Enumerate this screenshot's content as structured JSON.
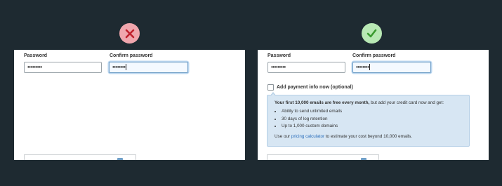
{
  "badges": {
    "bad": "x-icon",
    "good": "check-icon",
    "bad_color": "#f0a6ad",
    "good_color": "#b8e8b4"
  },
  "left": {
    "password_label": "Password",
    "password_value": "•••••••••",
    "confirm_label": "Confirm password",
    "confirm_value": "••••••••"
  },
  "right": {
    "password_label": "Password",
    "password_value": "•••••••••",
    "confirm_label": "Confirm password",
    "confirm_value": "••••••••",
    "checkbox_label": "Add payment info now (optional)",
    "info": {
      "intro_bold": "Your first 10,000 emails are free every month,",
      "intro_rest": " but add your credit card now and get:",
      "bullets": [
        "Ability to send unlimited emails",
        "30 days of log retention",
        "Up to 1,000 custom domains"
      ],
      "outro_pre": "Use our ",
      "outro_link": "pricing calculator",
      "outro_post": " to estimate your cost beyond 10,000 emails."
    }
  }
}
